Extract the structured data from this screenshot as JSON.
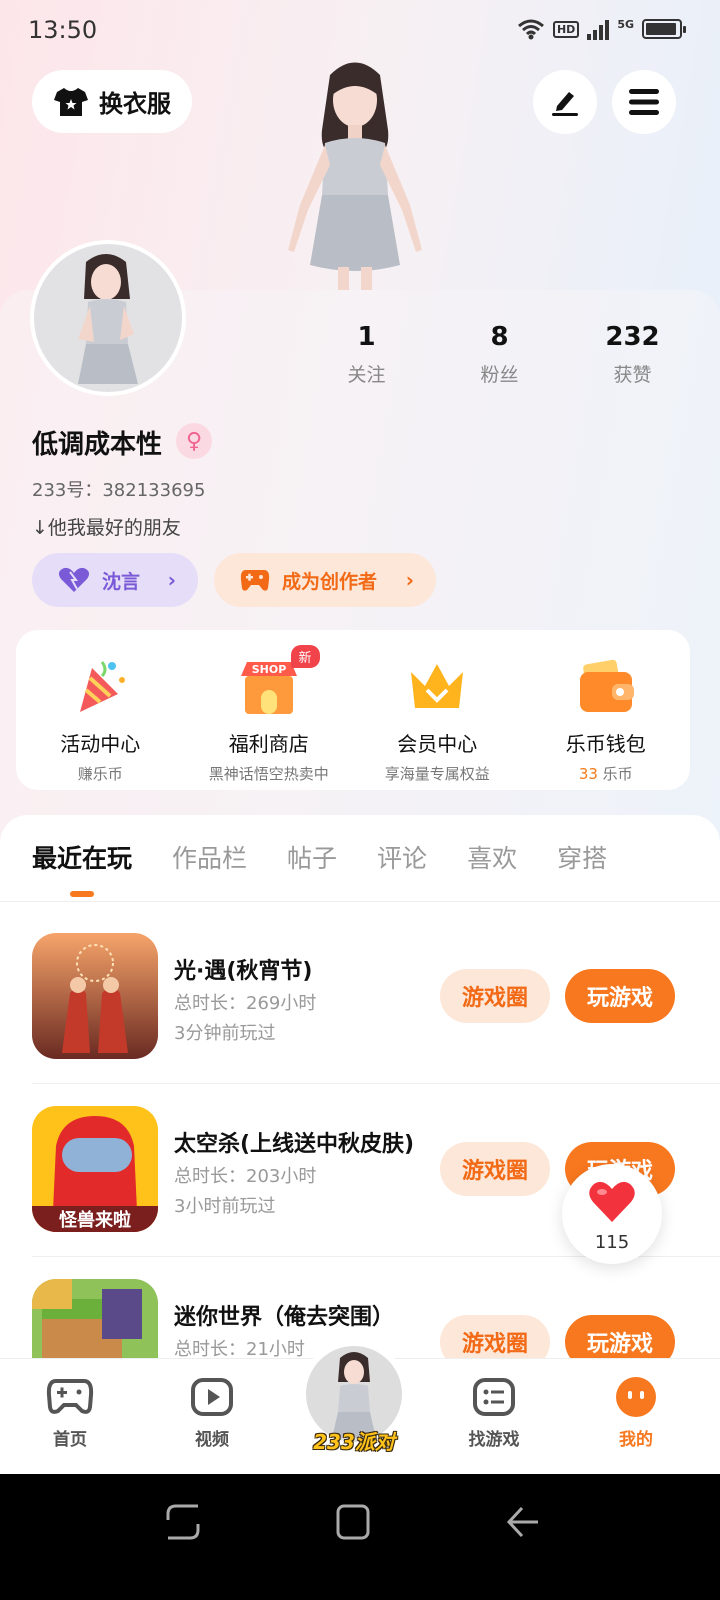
{
  "status_bar": {
    "time": "13:50",
    "network": "5G",
    "hd": "HD"
  },
  "header": {
    "change_clothes_label": "换衣服"
  },
  "profile": {
    "stats": [
      {
        "value": "1",
        "label": "关注"
      },
      {
        "value": "8",
        "label": "粉丝"
      },
      {
        "value": "232",
        "label": "获赞"
      }
    ],
    "nickname": "低调成本性",
    "uid_text": "233号：382133695",
    "bio": "↓他我最好的朋友",
    "chip_friend_label": "沈言",
    "chip_creator_label": "成为创作者"
  },
  "services": [
    {
      "title": "活动中心",
      "subtitle": "赚乐币",
      "icon": "party-popper-icon"
    },
    {
      "title": "福利商店",
      "subtitle": "黑神话悟空热卖中",
      "icon": "shop-icon",
      "badge": "新",
      "shop_text": "SHOP"
    },
    {
      "title": "会员中心",
      "subtitle": "享海量专属权益",
      "icon": "crown-icon"
    },
    {
      "title": "乐币钱包",
      "subtitle_value": "33",
      "subtitle_unit": " 乐币",
      "icon": "wallet-icon"
    }
  ],
  "tabs": [
    "最近在玩",
    "作品栏",
    "帖子",
    "评论",
    "喜欢",
    "穿搭"
  ],
  "games": [
    {
      "name": "光·遇(秋宵节)",
      "duration": "总时长：269小时",
      "last_played": "3分钟前玩过",
      "circle_label": "游戏圈",
      "play_label": "玩游戏"
    },
    {
      "name": "太空杀(上线送中秋皮肤)",
      "duration": "总时长：203小时",
      "last_played": "3小时前玩过",
      "circle_label": "游戏圈",
      "play_label": "玩游戏",
      "icon_caption": "怪兽来啦"
    },
    {
      "name": "迷你世界（俺去突围）",
      "duration": "总时长：21小时",
      "last_played": "",
      "circle_label": "游戏圈",
      "play_label": "玩游戏"
    }
  ],
  "floating_like": {
    "count": "115"
  },
  "bottom_nav": [
    {
      "label": "首页",
      "icon": "gamepad-icon"
    },
    {
      "label": "视频",
      "icon": "video-icon"
    },
    {
      "label": "233派对",
      "icon": "avatar"
    },
    {
      "label": "找游戏",
      "icon": "list-icon"
    },
    {
      "label": "我的",
      "icon": "profile-face-icon",
      "active": true
    }
  ],
  "colors": {
    "accent": "#f8781f",
    "purple": "#7a5ad6",
    "pink": "#f0648e"
  }
}
